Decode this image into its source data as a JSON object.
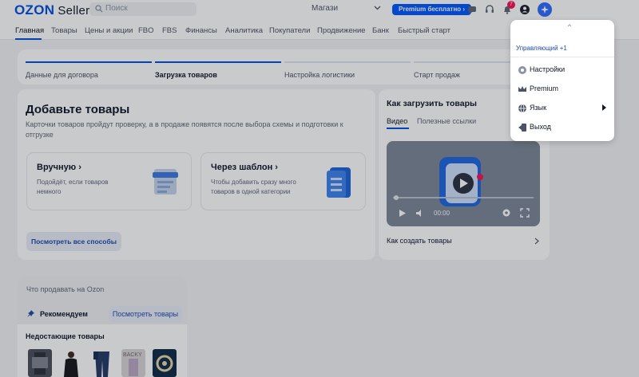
{
  "header": {
    "logo": "OZON",
    "logo_suffix": "Seller",
    "search_placeholder": "Поиск",
    "shops_label": "Магази",
    "premium_button": "Premium бесплатно ›",
    "notification_count": "7"
  },
  "nav": {
    "items": [
      "Главная",
      "Товары",
      "Цены и акции",
      "FBO",
      "FBS",
      "Финансы",
      "Аналитика",
      "Покупатели",
      "Продвижение",
      "Банк",
      "Быстрый старт"
    ]
  },
  "steps": {
    "items": [
      "Данные для договора",
      "Загрузка товаров",
      "Настройка логистики",
      "Старт продаж"
    ],
    "active_index": 1
  },
  "add_goods": {
    "title": "Добавьте товары",
    "description": "Карточки товаров пройдут проверку, а в продаже появятся после выбора схемы и подготовки к отгрузке",
    "manual_title": "Вручную",
    "manual_desc": "Подойдёт, если товаров немного",
    "template_title": "Через шаблон",
    "template_desc": "Чтобы добавить сразу много товаров в одной категории",
    "all_ways_button": "Посмотреть все способы"
  },
  "howto": {
    "title": "Как загрузить товары",
    "tabs": [
      "Видео",
      "Полезные ссылки"
    ],
    "video_time": "00:00",
    "link": "Как создать товары"
  },
  "what_to_sell": {
    "title": "Что продавать на Ozon",
    "recommend": "Рекомендуем",
    "see_goods_button": "Посмотреть товары",
    "missing_title": "Недостающие товары"
  },
  "dropdown": {
    "manager_label": "Управляющий +1",
    "items": [
      "Настройки",
      "Premium",
      "Язык",
      "Выход"
    ]
  },
  "colors": {
    "brand": "#0050e0",
    "premium": "#0057ff",
    "badge": "#f91155"
  }
}
